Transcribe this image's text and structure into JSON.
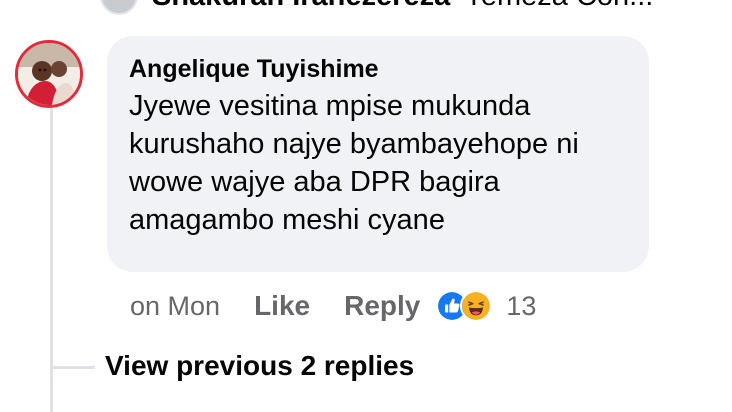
{
  "previous_comment": {
    "author": "Shakurah Iranezereza",
    "text": "Yemeza Con..."
  },
  "comment": {
    "author": "Angelique Tuyishime",
    "text": "Jyewe vesitina mpise mukunda kurushaho najye byambayehope ni wowe wajye aba DPR bagira amagambo meshi cyane",
    "timestamp": "on Mon",
    "like_label": "Like",
    "reply_label": "Reply",
    "reactions": {
      "icons": [
        "like-reaction-icon",
        "haha-reaction-icon"
      ],
      "count": "13"
    }
  },
  "view_previous_replies": "View previous 2 replies",
  "colors": {
    "bubble": "#f0f2f5",
    "meta_text": "#65676b",
    "like_blue": "#1877f2",
    "haha_yellow": "#f7b125",
    "thread_line": "#dfe1e5"
  }
}
